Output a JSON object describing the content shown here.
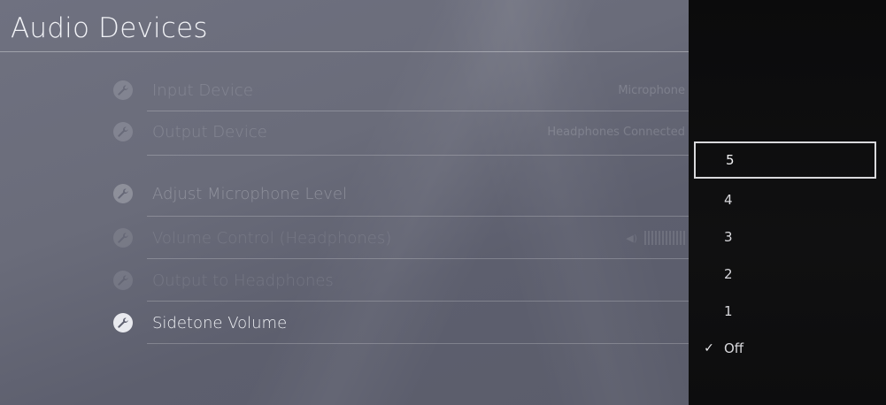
{
  "header": {
    "title": "Audio Devices"
  },
  "menu": {
    "items": [
      {
        "label": "Input Device",
        "value": "Microphone"
      },
      {
        "label": "Output Device",
        "value": "Headphones Connected"
      },
      {
        "label": "Adjust Microphone Level",
        "value": ""
      },
      {
        "label": "Volume Control (Headphones)",
        "value": ""
      },
      {
        "label": "Output to Headphones",
        "value": ""
      },
      {
        "label": "Sidetone Volume",
        "value": ""
      }
    ],
    "item_icon": "wrench-icon",
    "volume_icon": "speaker-icon"
  },
  "dropdown": {
    "options": [
      "5",
      "4",
      "3",
      "2",
      "1",
      "Off"
    ],
    "focused": "5",
    "checked": "Off",
    "check_glyph": "✓"
  },
  "colors": {
    "background": "#6a6c7a",
    "panel": "#0e0e0f",
    "text": "#eef0f4",
    "focus_border": "#d9d9dc"
  }
}
